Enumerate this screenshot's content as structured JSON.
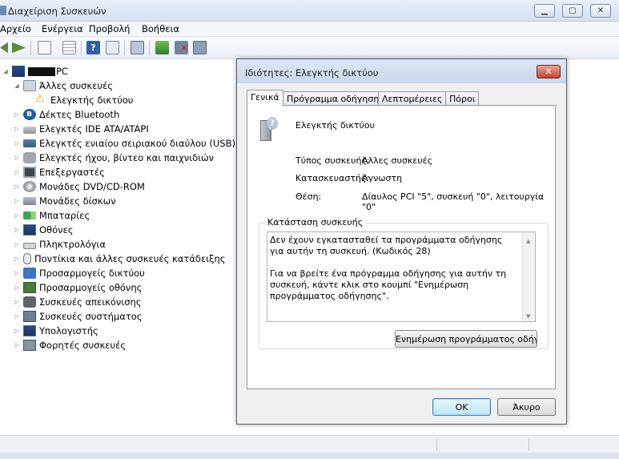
{
  "window": {
    "title": "Διαχείριση Συσκευών",
    "controls": [
      "minimize",
      "maximize",
      "close"
    ]
  },
  "menu": [
    "Αρχείο",
    "Ενέργεια",
    "Προβολή",
    "Βοήθεια"
  ],
  "toolbar": {
    "icons": [
      "back-icon",
      "forward-icon",
      "properties-icon",
      "list-icon",
      "help-icon",
      "view-icon",
      "scan-icon",
      "update-driver-icon",
      "uninstall-icon",
      "add-hardware-icon"
    ]
  },
  "tree": {
    "root": "PC",
    "other_devices": "Άλλες συσκευές",
    "network_controller": "Ελεγκτής δικτύου",
    "categories": [
      "Δέκτες Bluetooth",
      "Ελεγκτές IDE ATA/ATAPI",
      "Ελεγκτές ενιαίου σειριακού διαύλου (USB)",
      "Ελεγκτές ήχου, βίντεο και παιχνιδιών",
      "Επεξεργαστές",
      "Μονάδες DVD/CD-ROM",
      "Μονάδες δίσκων",
      "Μπαταρίες",
      "Οθόνες",
      "Πληκτρολόγια",
      "Ποντίκια και άλλες συσκευές κατάδειξης",
      "Προσαρμογείς δικτύου",
      "Προσαρμογείς οθόνης",
      "Συσκευές απεικόνισης",
      "Συσκευές συστήματος",
      "Υπολογιστής",
      "Φορητές συσκευές"
    ]
  },
  "dialog": {
    "title": "Ιδιότητες: Ελεγκτής δικτύου",
    "tabs": [
      "Γενικά",
      "Πρόγραμμα οδήγησης",
      "Λεπτομέρειες",
      "Πόροι"
    ],
    "device_name": "Ελεγκτής δικτύου",
    "props": {
      "type_label": "Τύπος συσκευής:",
      "type_value": "Άλλες συσκευές",
      "mfr_label": "Κατασκευαστής:",
      "mfr_value": "Άγνωστη",
      "loc_label": "Θέση:",
      "loc_value": "Δίαυλος PCI \"5\", συσκευή \"0\", λειτουργία \"0\""
    },
    "status_legend": "Κατάσταση συσκευής",
    "status_p1": "Δεν έχουν εγκατασταθεί τα προγράμματα οδήγησης για αυτήν τη συσκευή. (Κωδικός 28)",
    "status_p2": "Για να βρείτε ένα πρόγραμμα οδήγησης για αυτήν τη συσκευή, κάντε κλικ στο κουμπί \"Ενημέρωση προγράμματος οδήγησης\".",
    "update_button": "Ενημέρωση προγράμματος οδήγησης",
    "ok": "OK",
    "cancel": "Άκυρο"
  }
}
